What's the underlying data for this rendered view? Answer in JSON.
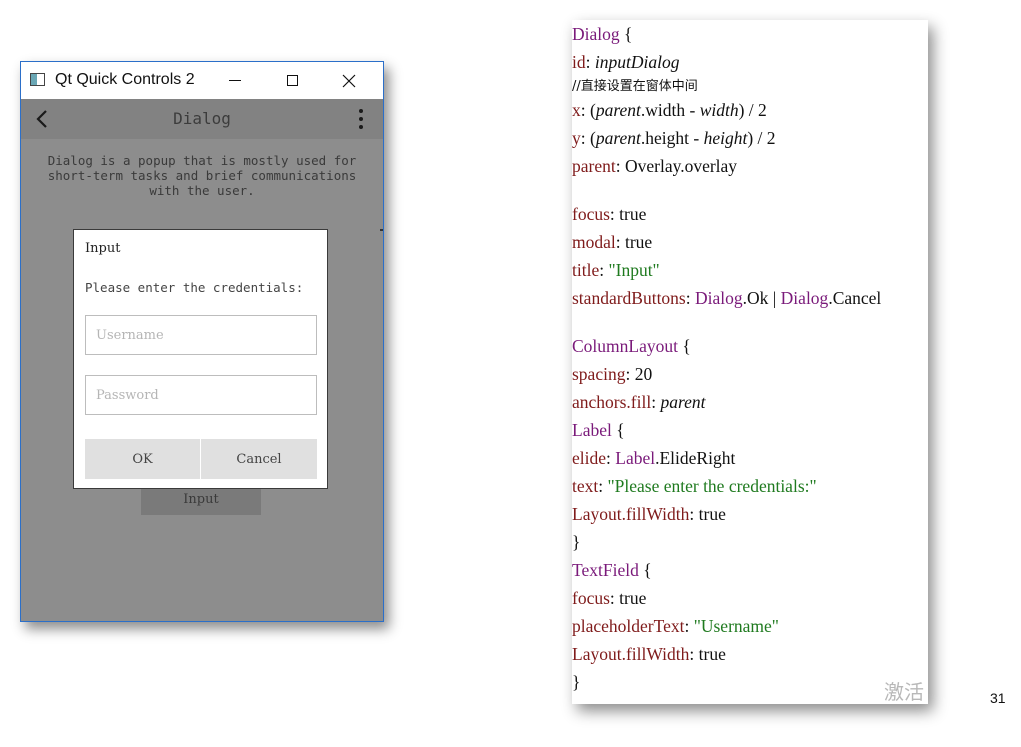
{
  "window": {
    "title": "Qt Quick Controls 2",
    "toolbar_title": "Dialog",
    "description": "Dialog is a popup that is mostly used for short-term tasks and brief communications with the user.",
    "input_button_label": "Input"
  },
  "dialog": {
    "title": "Input",
    "label": "Please enter the credentials:",
    "username_placeholder": "Username",
    "password_placeholder": "Password",
    "ok_label": "OK",
    "cancel_label": "Cancel"
  },
  "code": {
    "l1": [
      "Dialog",
      " {"
    ],
    "l2": [
      "id",
      ": ",
      "inputDialog"
    ],
    "l3": "//直接设置在窗体中间",
    "l4": [
      "x",
      ": (",
      "parent",
      ".width - ",
      "width",
      ") / 2"
    ],
    "l5": [
      "y",
      ": (",
      "parent",
      ".height - ",
      "height",
      ") / 2"
    ],
    "l6": [
      "parent",
      ": Overlay.overlay"
    ],
    "l7": [
      "focus",
      ": true"
    ],
    "l8": [
      "modal",
      ": true"
    ],
    "l9": [
      "title",
      ": ",
      "\"Input\""
    ],
    "l10": [
      "standardButtons",
      ": ",
      "Dialog",
      ".Ok | ",
      "Dialog",
      ".Cancel"
    ],
    "l11": [
      "ColumnLayout",
      " {"
    ],
    "l12": [
      "spacing",
      ": 20"
    ],
    "l13": [
      "anchors.fill",
      ": ",
      "parent"
    ],
    "l14": [
      "Label",
      " {"
    ],
    "l15": [
      "elide",
      ": ",
      "Label",
      ".ElideRight"
    ],
    "l16": [
      "text",
      ": ",
      "\"Please enter the credentials:\""
    ],
    "l17": [
      "Layout.fillWidth",
      ": true"
    ],
    "l18": "}",
    "l19": [
      "TextField",
      " {"
    ],
    "l20": [
      "focus",
      ": true"
    ],
    "l21": [
      "placeholderText",
      ": ",
      "\"Username\""
    ],
    "l22": [
      "Layout.fillWidth",
      ": true"
    ],
    "l23": "}",
    "watermark": "激活"
  },
  "page_number": "31"
}
